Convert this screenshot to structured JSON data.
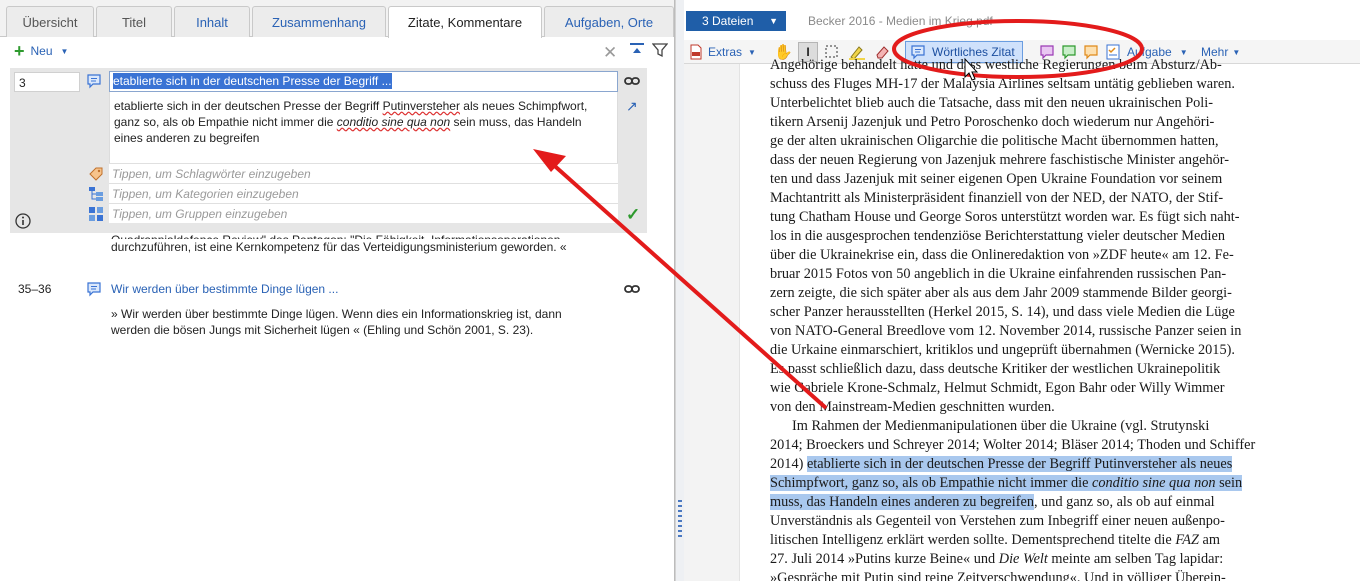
{
  "tabs": [
    {
      "label": "Übersicht",
      "style": "gray"
    },
    {
      "label": "Titel",
      "style": "gray"
    },
    {
      "label": "Inhalt",
      "style": "link"
    },
    {
      "label": "Zusammenhang",
      "style": "link"
    },
    {
      "label": "Zitate, Kommentare",
      "style": "active"
    },
    {
      "label": "Aufgaben, Orte",
      "style": "link"
    }
  ],
  "left_toolbar": {
    "new_label": "Neu"
  },
  "entry1": {
    "number": "3",
    "title": "etablierte sich in der deutschen Presse der Begriff ...",
    "text_part1": "etablierte sich in der deutschen Presse der Begriff ",
    "text_word": "Putinversteher",
    "text_part2": " als neues Schimpfwort, ganz so, als ob Empathie nicht immer die ",
    "text_italic": "conditio sine qua non",
    "text_part3": " sein muss, das Handeln eines anderen zu begreifen",
    "keywords_placeholder": "Tippen, um Schlagwörter einzugeben",
    "categories_placeholder": "Tippen, um Kategorien einzugeben",
    "groups_placeholder": "Tippen, um Gruppen einzugeben"
  },
  "bleed_text": {
    "line1": "Quadrannialdefence Review\" des Pentagon: \"Die Fähigkeit, Informationsoperationen",
    "line2": "durchzuführen, ist eine Kernkompetenz für das Verteidigungsministerium geworden. «"
  },
  "entry2": {
    "number": "35–36",
    "title": "Wir werden über bestimmte Dinge lügen ...",
    "line1": "» Wir werden über bestimmte Dinge lügen. Wenn dies ein Informationskrieg ist, dann",
    "line2": "werden die bösen Jungs mit Sicherheit lügen « (Ehling und Schön 2001, S. 23)."
  },
  "right": {
    "files_label": "3 Dateien",
    "doc_title": "Becker 2016 - Medien im Krieg.pdf",
    "extras_label": "Extras",
    "wz_label": "Wörtliches Zitat",
    "aufgabe_label": "Aufgabe",
    "mehr_label": "Mehr"
  },
  "doc_lines": [
    "Angehörige behandelt hatte und dass westliche Regierungen beim Absturz/Ab-",
    "schuss des Fluges MH-17 der Malaysia Airlines seltsam untätig geblieben waren.",
    "Unterbelichtet blieb auch die Tatsache, dass mit den neuen ukrainischen Poli-",
    "tikern Arsenij Jazenjuk und Petro Poroschenko doch wiederum nur Angehöri-",
    "ge der alten ukrainischen Oligarchie die politische Macht übernommen hatten,",
    "dass der neuen Regierung von Jazenjuk mehrere faschistische Minister angehör-",
    "ten und dass Jazenjuk mit seiner eigenen Open Ukraine Foundation vor seinem",
    "Machtantritt als Ministerpräsident finanziell von der NED, der NATO, der Stif-",
    "tung Chatham House und George Soros unterstützt worden war. Es fügt sich naht-",
    "los in die ausgesprochen tendenziöse Berichterstattung vieler deutscher Medien",
    "über die Ukrainekrise ein, dass die Onlineredaktion von »ZDF heute« am 12. Fe-",
    "bruar 2015 Fotos von 50 angeblich in die Ukraine einfahrenden russischen Pan-",
    "zern zeigte, die sich später aber als aus dem Jahr 2009 stammende Bilder georgi-",
    "scher Panzer herausstellten (Herkel 2015, S. 14), und dass viele Medien die Lüge",
    "von NATO-General Breedlove vom 12. November 2014, russische Panzer seien in",
    "die Urkaine einmarschiert, kritiklos und ungeprüft übernahmen (Wernicke 2015).",
    "Es passt schließlich dazu, dass deutsche Kritiker der westlichen Ukrainepolitik",
    "wie Gabriele Krone-Schmalz, Helmut Schmidt, Egon Bahr oder Willy Wimmer",
    "von den Mainstream-Medien geschnitten wurden.",
    "Im Rahmen der Medienmanipulationen über die Ukraine (vgl. Strutynski",
    "2014; Broeckers und Schreyer 2014; Wolter 2014; Bläser 2014; Thoden und Schiffer",
    "2014) ",
    "etablierte sich in der deutschen Presse der Begriff Putinversteher als neues",
    "Schimpfwort, ganz so, als ob Empathie nicht immer die ",
    "conditio sine qua non",
    " sein",
    "muss, das Handeln eines anderen zu begreifen",
    ", und ganz so, als ob auf einmal",
    "Unverständnis als Gegenteil von Verstehen zum Inbegriff einer neuen außenpo-",
    "litischen Intelligenz erklärt werden sollte. Dementsprechend titelte die ",
    "FAZ",
    " am",
    "27. Juli 2014 »Putins kurze Beine« und ",
    "Die Welt",
    " meinte am selben Tag lapidar:",
    "»Gespräche mit Putin sind reine Zeitverschwendung«. Und in völliger Überein-"
  ],
  "colors": {
    "accent": "#2a62b5",
    "highlight": "#a9c8ee",
    "annotation_red": "#e31b1b"
  }
}
